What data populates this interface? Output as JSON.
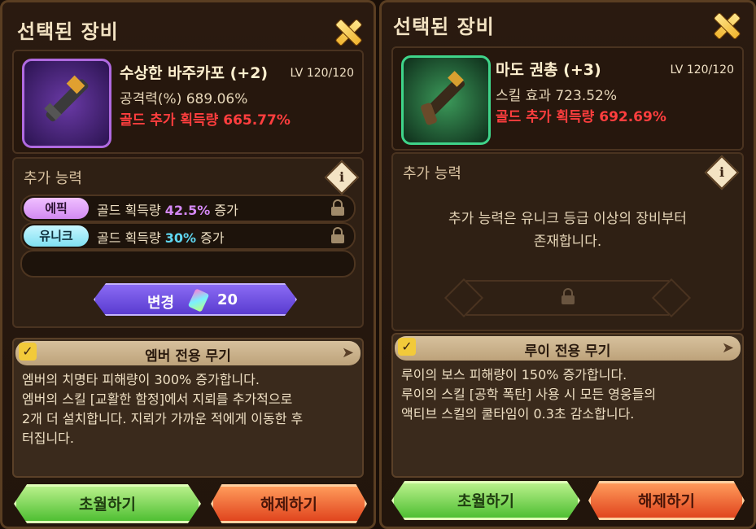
{
  "left": {
    "title": "선택된 장비",
    "equip": {
      "name": "수상한 바주카포 (+2)",
      "level": "LV 120/120",
      "stat": "공격력(%) 689.06%",
      "gold": "골드 추가 획득량 665.77%"
    },
    "ability": {
      "title": "추가 능력",
      "info": "i",
      "rows": [
        {
          "badge": "에픽",
          "text_pre": "골드 획득량 ",
          "value": "42.5%",
          "text_post": " 증가"
        },
        {
          "badge": "유니크",
          "text_pre": "골드 획득량 ",
          "value": "30%",
          "text_post": " 증가"
        }
      ],
      "change_label": "변경",
      "change_cost": "20"
    },
    "exclusive": {
      "title": "엠버 전용 무기",
      "lines": [
        "엠버의 치명타 피해량이 300% 증가합니다.",
        "엠버의 스킬 [교활한 함정]에서 지뢰를 추가적으로",
        "2개 더 설치합니다. 지뢰가 가까운 적에게 이동한 후",
        "터집니다."
      ]
    },
    "buttons": {
      "transcend": "초월하기",
      "release": "해제하기"
    }
  },
  "right": {
    "title": "선택된 장비",
    "equip": {
      "name": "마도 권총 (+3)",
      "level": "LV 120/120",
      "stat": "스킬 효과 723.52%",
      "gold": "골드 추가 획득량 692.69%"
    },
    "ability": {
      "title": "추가 능력",
      "info": "i",
      "message_line1": "추가 능력은 유니크 등급 이상의 장비부터",
      "message_line2": "존재합니다."
    },
    "exclusive": {
      "title": "루이 전용 무기",
      "lines": [
        "루이의 보스 피해량이 150% 증가합니다.",
        "루이의 스킬 [공학 폭탄] 사용 시 모든 영웅들의",
        "액티브 스킬의 쿨타임이 0.3초 감소합니다."
      ]
    },
    "buttons": {
      "transcend": "초월하기",
      "release": "해제하기"
    }
  },
  "colors": {
    "gold_text": "#ff3e3e",
    "epic": "#d488f5",
    "unique": "#5fd6f0",
    "accent": "#f0b530"
  },
  "icons": {
    "close": "close-x-icon",
    "info": "info-icon",
    "lock": "lock-icon",
    "check": "check-icon",
    "gem": "gem-icon"
  }
}
